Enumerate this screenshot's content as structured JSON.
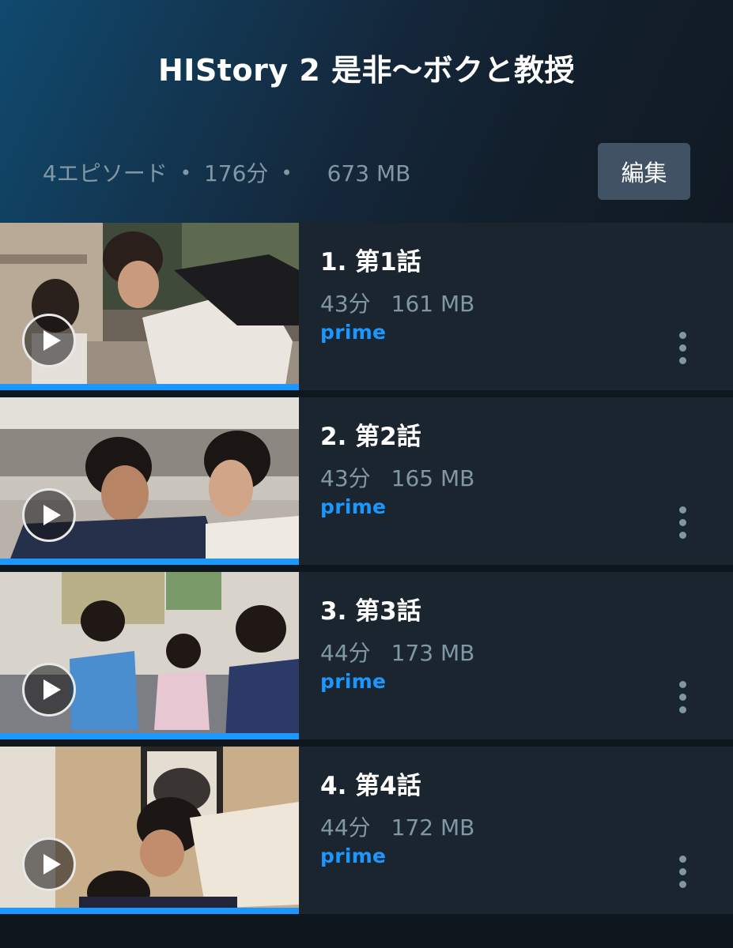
{
  "header": {
    "title": "HIStory 2 是非～ボクと教授",
    "episode_count": "4エピソード",
    "duration": "176分",
    "size": "673 MB",
    "edit_label": "編集"
  },
  "colors": {
    "background": "#0f171e",
    "row_background": "#1b2530",
    "accent": "#1a98ff",
    "secondary_text": "#8197a4",
    "button": "#425265"
  },
  "episodes": [
    {
      "title": "1. 第1話",
      "duration": "43分",
      "size": "161 MB",
      "badge": "prime",
      "progress": 1.0
    },
    {
      "title": "2. 第2話",
      "duration": "43分",
      "size": "165 MB",
      "badge": "prime",
      "progress": 1.0
    },
    {
      "title": "3. 第3話",
      "duration": "44分",
      "size": "173 MB",
      "badge": "prime",
      "progress": 1.0
    },
    {
      "title": "4. 第4話",
      "duration": "44分",
      "size": "172 MB",
      "badge": "prime",
      "progress": 1.0
    }
  ],
  "icons": {
    "play": "play-icon",
    "more": "more-vertical-icon"
  }
}
